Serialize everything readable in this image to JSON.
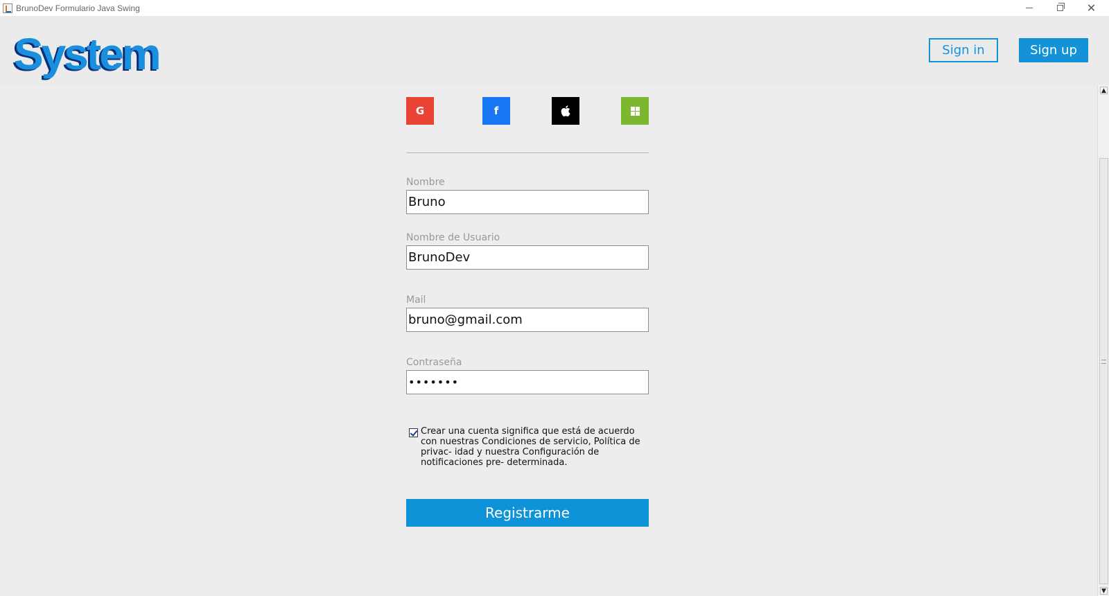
{
  "window": {
    "title": "BrunoDev Formulario Java Swing"
  },
  "header": {
    "logo": "System",
    "sign_in": "Sign in",
    "sign_up": "Sign up"
  },
  "social": {
    "google_glyph": "G",
    "facebook_glyph": "f",
    "apple_glyph": "",
    "icons": [
      "google-icon",
      "facebook-icon",
      "apple-icon",
      "windows-icon"
    ]
  },
  "form": {
    "nombre_label": "Nombre",
    "nombre_value": "Bruno",
    "usuario_label": "Nombre de Usuario",
    "usuario_value": "BrunoDev",
    "mail_label": "Mail",
    "mail_value": "bruno@gmail.com",
    "password_label": "Contraseña",
    "password_value": "•••••••",
    "terms_checked": true,
    "terms_text": "Crear una cuenta significa que está de acuerdo con nuestras Condiciones de servicio, Política de privac- idad y nuestra  Configuración de notificaciones pre- determinada.",
    "register_label": "Registrarme"
  },
  "colors": {
    "accent": "#1392d8",
    "google": "#ea4335",
    "facebook": "#1877f2",
    "apple": "#000000",
    "windows": "#7cb82f",
    "background": "#ededed"
  }
}
